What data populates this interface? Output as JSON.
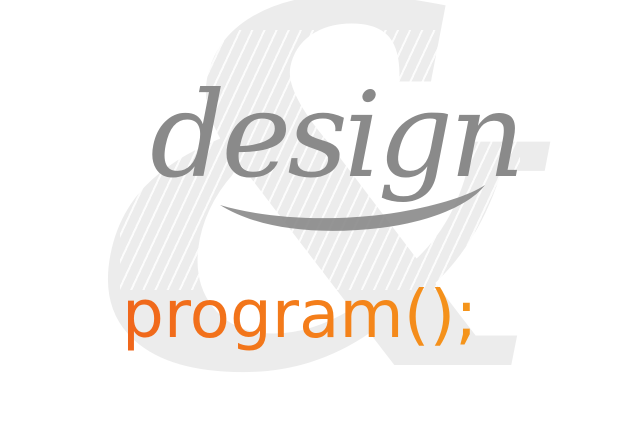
{
  "logo": {
    "background_glyph": "&",
    "script_word": "design",
    "code_word": "program();"
  },
  "colors": {
    "background": "#ffffff",
    "ampersand": "#ececec",
    "script_text": "#8a8a8a",
    "code_gradient_start": "#f0661b",
    "code_gradient_end": "#f5a01c"
  }
}
